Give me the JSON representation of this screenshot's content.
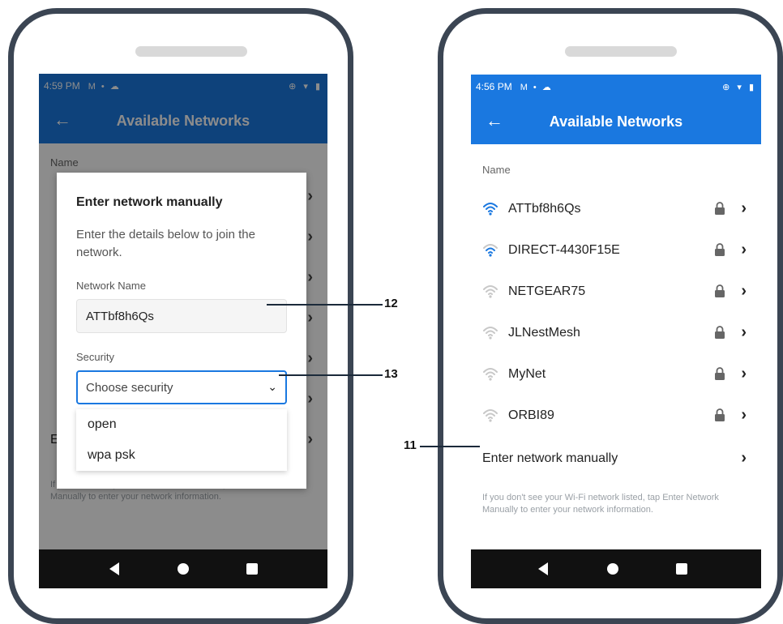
{
  "left_phone": {
    "status_time": "4:59 PM",
    "status_icons_left": "M • ☁",
    "status_icons_right": "⊕ ▾ ▮",
    "appbar_title": "Available Networks",
    "name_section": "Name",
    "background_manual_label": "E",
    "footnote": "If you don't see your Wi-Fi network listed, tap Enter Network Manually to enter your network information.",
    "dialog": {
      "title": "Enter network manually",
      "description": "Enter the details below to join the network.",
      "network_name_label": "Network Name",
      "network_name_value": "ATTbf8h6Qs",
      "security_label": "Security",
      "security_placeholder": "Choose security",
      "security_options": [
        "open",
        "wpa psk"
      ]
    }
  },
  "right_phone": {
    "status_time": "4:56 PM",
    "status_icons_left": "M • ☁",
    "status_icons_right": "⊕ ▾ ▮",
    "appbar_title": "Available Networks",
    "name_section": "Name",
    "networks": [
      {
        "ssid": "ATTbf8h6Qs",
        "signal": "strong"
      },
      {
        "ssid": "DIRECT-4430F15E",
        "signal": "medium"
      },
      {
        "ssid": "NETGEAR75",
        "signal": "weak"
      },
      {
        "ssid": "JLNestMesh",
        "signal": "weak"
      },
      {
        "ssid": "MyNet",
        "signal": "weak"
      },
      {
        "ssid": "ORBI89",
        "signal": "weak"
      }
    ],
    "manual_entry_label": "Enter network manually",
    "footnote": "If you don't see your Wi-Fi network listed, tap Enter Network Manually to enter your network information."
  },
  "callouts": {
    "c11": "11",
    "c12": "12",
    "c13": "13"
  },
  "colors": {
    "accent": "#1a78e0",
    "phone_frame": "#3b4553",
    "signal_strong": "#1a78e0",
    "signal_weak": "#c8c8c8"
  },
  "icons": {
    "back": "arrow-left-icon",
    "wifi": "wifi-icon",
    "lock": "lock-icon",
    "chevron": "chevron-right-icon",
    "dropdown": "chevron-down-icon"
  }
}
